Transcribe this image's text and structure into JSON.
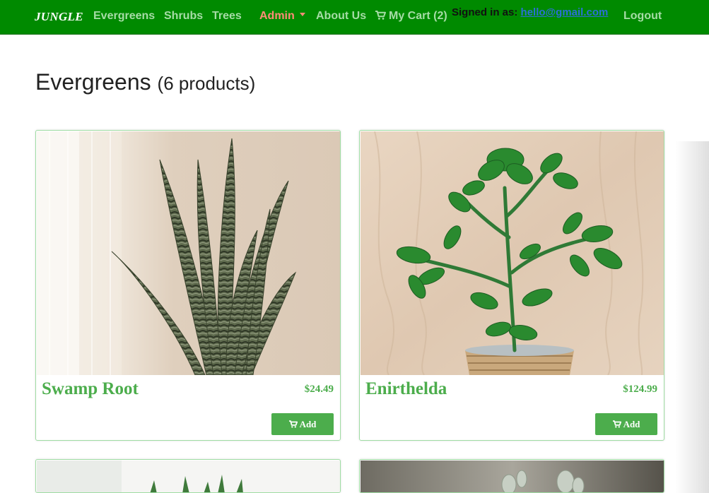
{
  "navbar": {
    "brand": "JUNGLE",
    "links": [
      "Evergreens",
      "Shrubs",
      "Trees"
    ],
    "admin": "Admin",
    "about": "About Us",
    "cart": "My Cart (2)",
    "signed_in_label": "Signed in as:",
    "email": "hello@gmail.com",
    "logout": "Logout"
  },
  "page": {
    "title": "Evergreens",
    "count": "(6 products)"
  },
  "products": [
    {
      "name": "Swamp Root",
      "price": "$24.49",
      "button": "Add"
    },
    {
      "name": "Enirthelda",
      "price": "$124.99",
      "button": "Add"
    }
  ],
  "colors": {
    "navbar": "#008a00",
    "nav_link": "#a6dca6",
    "admin": "#ff8c78",
    "accent_green": "#4cad4c",
    "card_border": "#9fdca3",
    "email_link": "#2b6fd6"
  },
  "icons": [
    "cart-icon",
    "caret-down-icon"
  ]
}
